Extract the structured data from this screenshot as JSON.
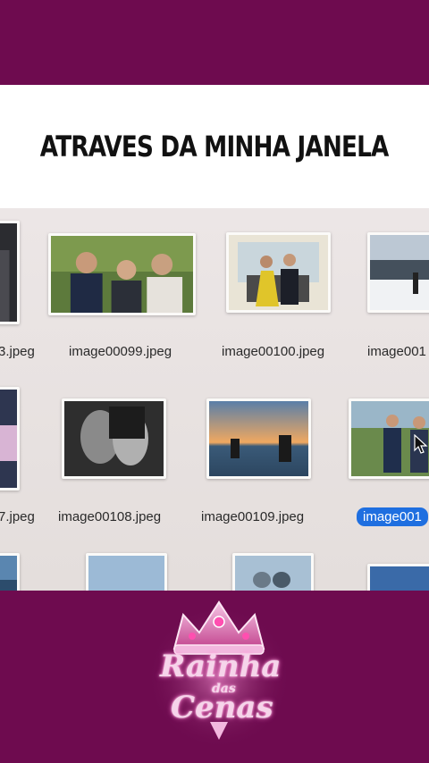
{
  "header": {
    "title": "ATRAVES DA MINHA JANELA"
  },
  "files": {
    "row1": [
      "3.jpeg",
      "image00099.jpeg",
      "image00100.jpeg",
      "image001"
    ],
    "row2": [
      "7.jpeg",
      "image00108.jpeg",
      "image00109.jpeg",
      "image001"
    ]
  },
  "selected_file_index": 3,
  "branding": {
    "logo_word1": "Rainha",
    "logo_word2": "das",
    "logo_word3": "Cenas"
  },
  "colors": {
    "band": "#6e0b4f",
    "selection": "#1f6fe0",
    "accent_pink": "#ff7fcf"
  }
}
